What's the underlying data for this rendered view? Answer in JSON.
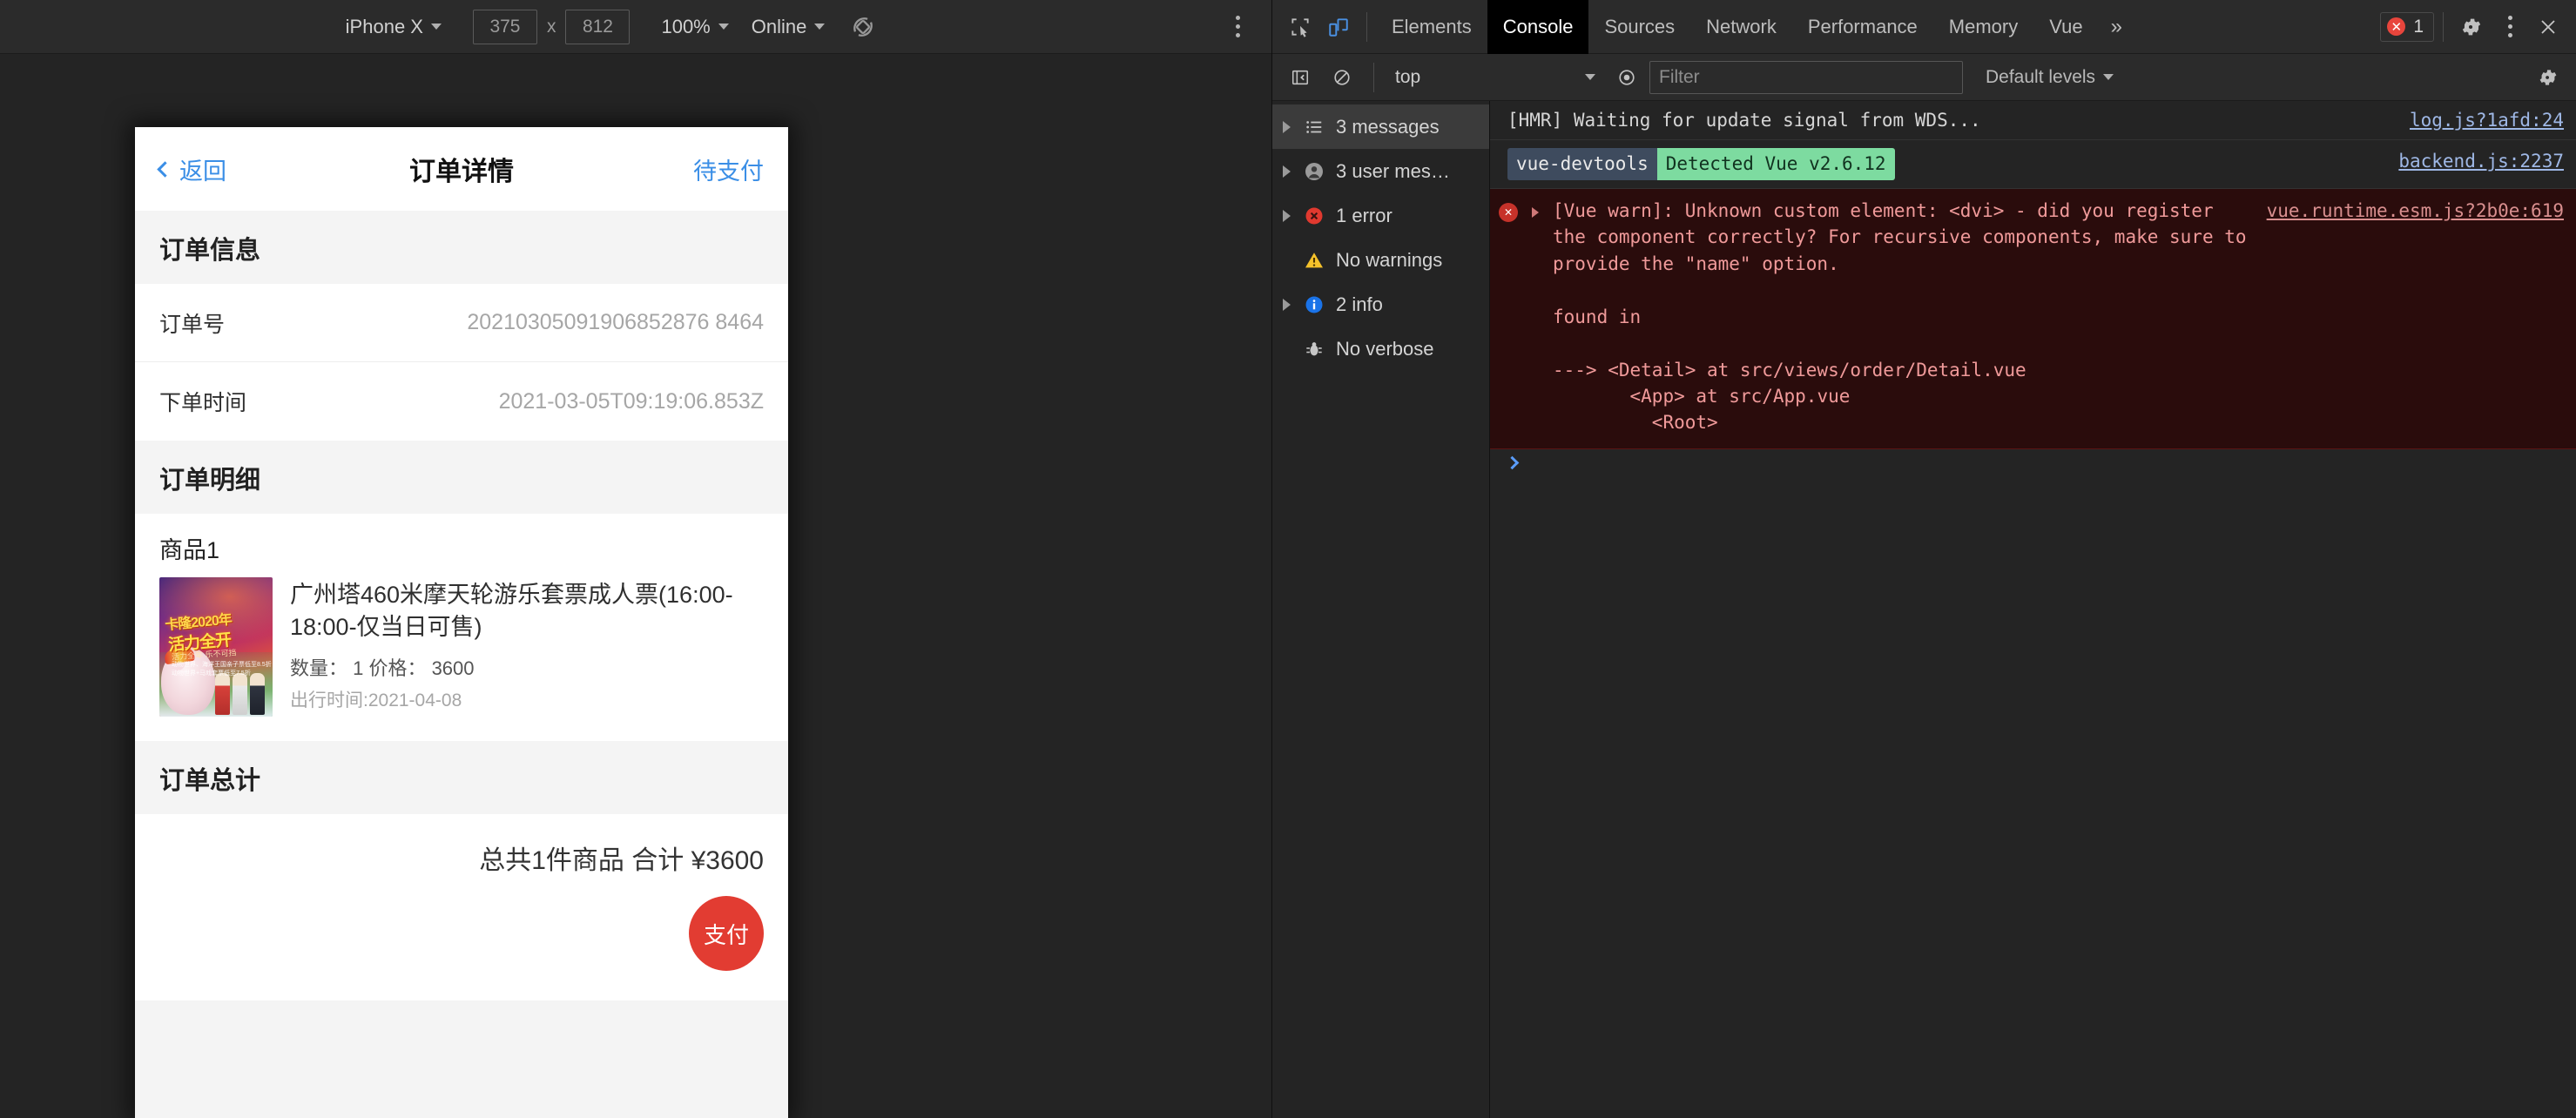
{
  "device_toolbar": {
    "device_name": "iPhone X",
    "width": "375",
    "height": "812",
    "x_label": "x",
    "zoom": "100%",
    "throttling": "Online",
    "rotate_icon": "rotate-device-icon",
    "more_options_icon": "more-options-icon"
  },
  "app": {
    "back_label": "返回",
    "title": "订单详情",
    "status": "待支付",
    "order_info": {
      "section_title": "订单信息",
      "rows": [
        {
          "key": "订单号",
          "value": "20210305091906852876 8464"
        },
        {
          "key": "下单时间",
          "value": "2021-03-05T09:19:06.853Z"
        }
      ]
    },
    "order_detail": {
      "section_title": "订单明细",
      "item_label": "商品1",
      "product_name": "广州塔460米摩天轮游乐套票成人票(16:00-18:00-仅当日可售)",
      "qty_price": "数量： 1 价格： 3600",
      "travel_date": "出行时间:2021-04-08",
      "poster": {
        "line1": "卡隆2020年",
        "line2": "活力全开",
        "line3": "活力全年  乐不可挡",
        "line4": "动物世界、海洋王国亲子票低至8.5折",
        "line5": "动物世界+马戏套票低至7.5折"
      }
    },
    "order_total": {
      "section_title": "订单总计",
      "summary": "总共1件商品 合计 ¥3600",
      "pay_button": "支付",
      "pay_button_color": "#e23c32"
    }
  },
  "devtools": {
    "inspect_icon": "inspect-element-icon",
    "device_toggle_icon": "toggle-device-toolbar-icon",
    "tabs": [
      {
        "label": "Elements",
        "active": false
      },
      {
        "label": "Console",
        "active": true
      },
      {
        "label": "Sources",
        "active": false
      },
      {
        "label": "Network",
        "active": false
      },
      {
        "label": "Performance",
        "active": false
      },
      {
        "label": "Memory",
        "active": false
      },
      {
        "label": "Vue",
        "active": false
      }
    ],
    "more_tabs": "»",
    "error_count": "1",
    "settings_icon": "gear-icon",
    "main_menu_icon": "more-options-icon",
    "close_icon": "close-icon",
    "console_toolbar": {
      "sidebar_toggle_icon": "show-console-sidebar-icon",
      "clear_icon": "clear-console-icon",
      "context": "top",
      "eye_icon": "live-expression-icon",
      "filter_placeholder": "Filter",
      "filter_value": "",
      "levels": "Default levels",
      "settings_icon": "console-settings-gear-icon"
    },
    "sidebar": [
      {
        "label": "3 messages",
        "icon": "list-icon",
        "expandable": true,
        "selected": true
      },
      {
        "label": "3 user mes…",
        "icon": "user-icon",
        "expandable": true,
        "selected": false
      },
      {
        "label": "1 error",
        "icon": "error-icon",
        "expandable": true,
        "selected": false
      },
      {
        "label": "No warnings",
        "icon": "warning-icon",
        "expandable": false,
        "selected": false
      },
      {
        "label": "2 info",
        "icon": "info-icon",
        "expandable": true,
        "selected": false
      },
      {
        "label": "No verbose",
        "icon": "bug-icon",
        "expandable": false,
        "selected": false
      }
    ],
    "messages": {
      "hmr": {
        "text": "[HMR] Waiting for update signal from WDS...",
        "source": "log.js?1afd:24"
      },
      "vuedevtools": {
        "tag": "vue-devtools",
        "text": "Detected Vue v2.6.12",
        "source": "backend.js:2237"
      },
      "error": {
        "text": "[Vue warn]: Unknown custom element: <dvi> - did you register the component correctly? For recursive components, make sure to provide the \"name\" option.\n\nfound in\n\n---> <Detail> at src/views/order/Detail.vue\n       <App> at src/App.vue\n         <Root>",
        "source": "vue.runtime.esm.js?2b0e:619"
      }
    },
    "prompt": ">"
  }
}
